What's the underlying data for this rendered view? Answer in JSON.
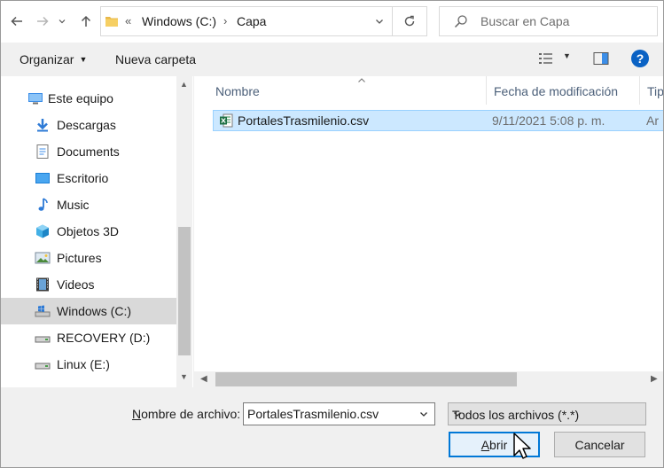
{
  "addressbar": {
    "overflow_chevron": "«",
    "crumbs": [
      "Windows (C:)",
      "Capa"
    ],
    "separator": "›"
  },
  "search": {
    "placeholder": "Buscar en Capa"
  },
  "toolbar": {
    "organize_label": "Organizar",
    "new_folder_label": "Nueva carpeta",
    "help_label": "?"
  },
  "navpane": {
    "items": [
      {
        "label": "Este equipo",
        "icon": "computer-icon"
      },
      {
        "label": "Descargas",
        "icon": "downloads-icon"
      },
      {
        "label": "Documents",
        "icon": "documents-icon"
      },
      {
        "label": "Escritorio",
        "icon": "desktop-icon"
      },
      {
        "label": "Music",
        "icon": "music-icon"
      },
      {
        "label": "Objetos 3D",
        "icon": "objects-3d-icon"
      },
      {
        "label": "Pictures",
        "icon": "pictures-icon"
      },
      {
        "label": "Videos",
        "icon": "videos-icon"
      },
      {
        "label": "Windows (C:)",
        "icon": "system-drive-icon",
        "selected": true
      },
      {
        "label": "RECOVERY (D:)",
        "icon": "drive-icon"
      },
      {
        "label": "Linux (E:)",
        "icon": "drive-icon"
      }
    ]
  },
  "filelist": {
    "columns": [
      "Nombre",
      "Fecha de modificación",
      "Tipo"
    ],
    "rows": [
      {
        "name": "PortalesTrasmilenio.csv",
        "date": "9/11/2021 5:08 p. m.",
        "type": "Ar",
        "icon": "excel-csv-icon",
        "selected": true
      }
    ]
  },
  "bottom": {
    "filename_label_prefix": "N",
    "filename_label_rest": "ombre de archivo:",
    "filename_value": "PortalesTrasmilenio.csv",
    "filetype_value": "Todos los archivos (*.*)",
    "open_label_prefix": "A",
    "open_label_rest": "brir",
    "cancel_label": "Cancelar"
  },
  "colors": {
    "accent": "#0078d7",
    "selection": "#cce8ff",
    "nav_selected": "#d9d9d9"
  }
}
